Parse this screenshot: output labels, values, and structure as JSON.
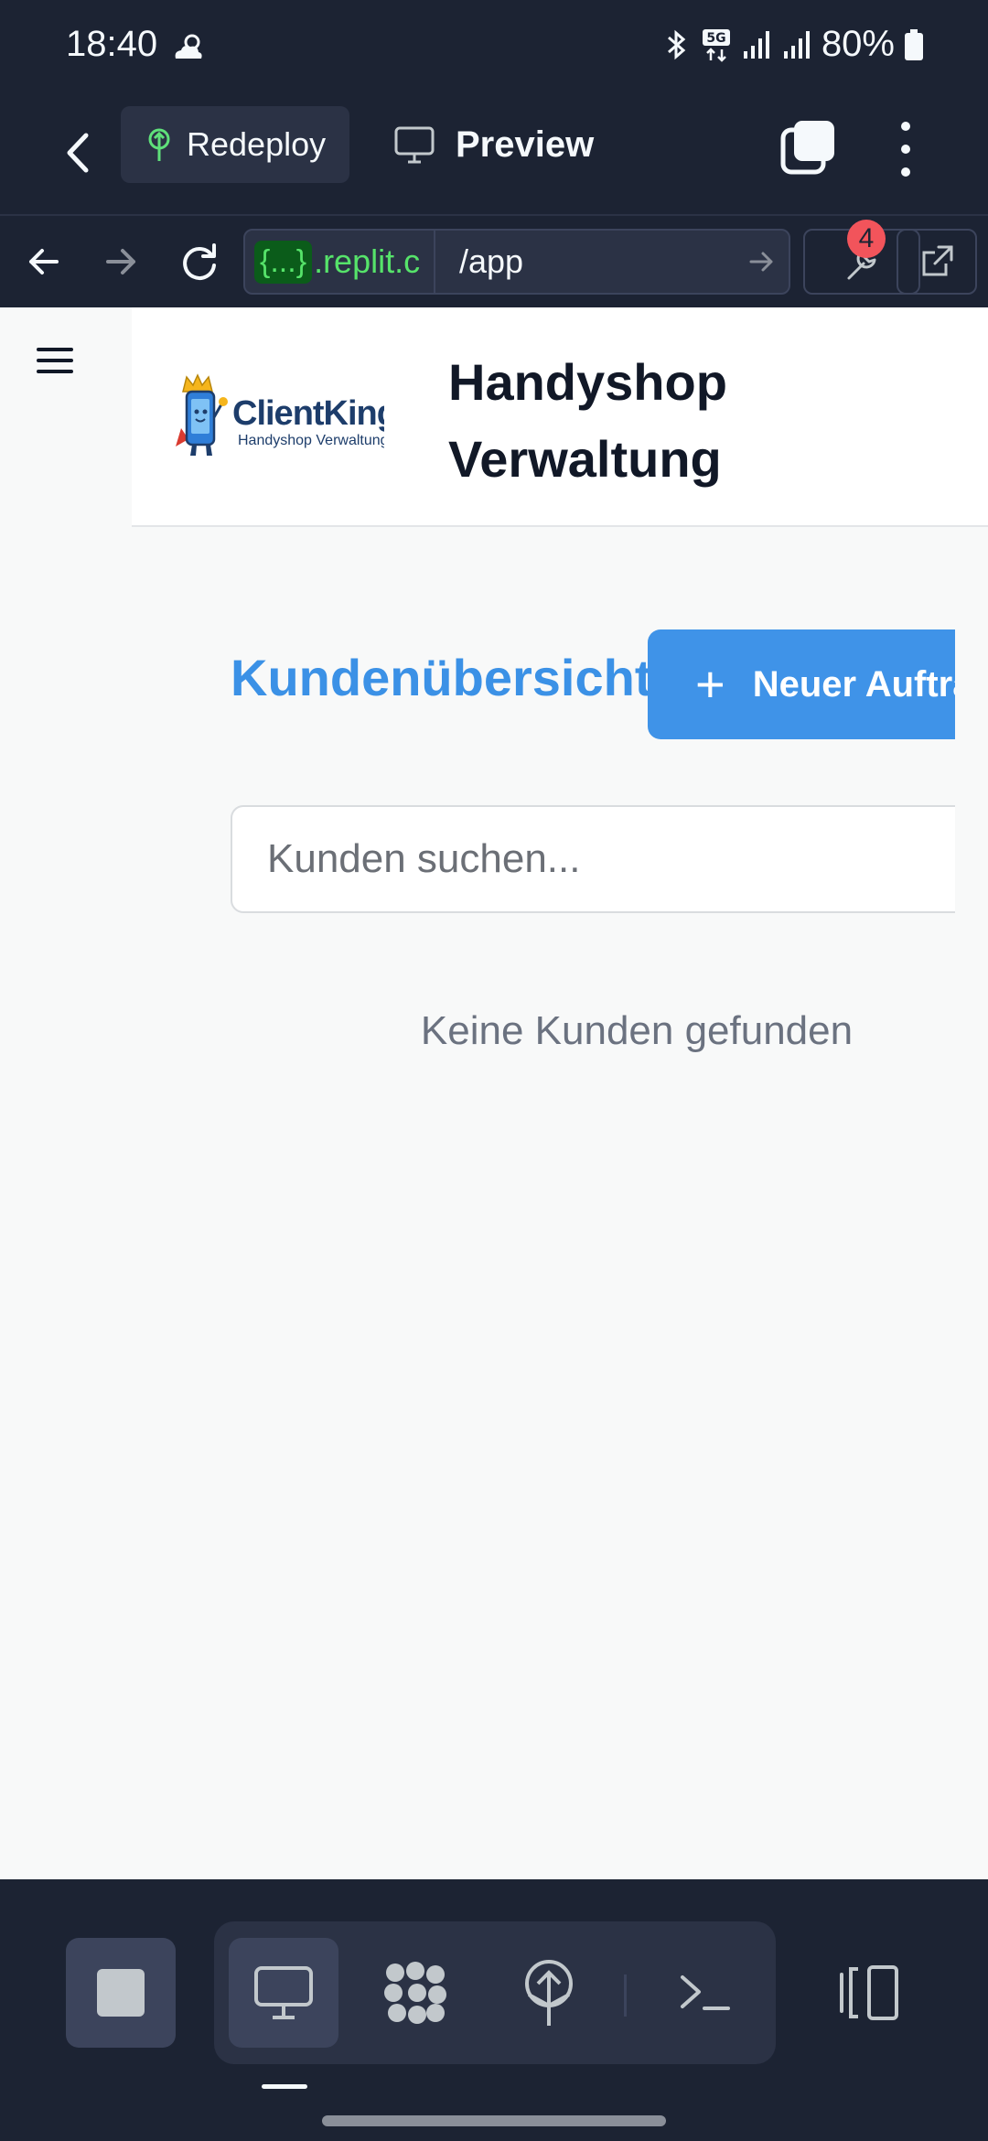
{
  "status_bar": {
    "time": "18:40",
    "battery": "80%",
    "icons": [
      "cloud-sun-icon",
      "bluetooth-icon",
      "5g-icon",
      "signal-icon",
      "signal-icon",
      "battery-icon"
    ]
  },
  "replit_header": {
    "redeploy_label": "Redeploy",
    "preview_label": "Preview"
  },
  "url_bar": {
    "host_badge": "{...}",
    "host_domain": ".replit.c",
    "path": "/app",
    "notification_count": "4"
  },
  "app": {
    "logo_text": "ClientKing",
    "logo_subtitle": "Handyshop Verwaltung",
    "title_line1": "Handyshop",
    "title_line2": "Verwaltung",
    "page_title": "Kundenübersicht",
    "new_order_button": "Neuer Auftrag",
    "search_placeholder": "Kunden suchen...",
    "empty_message": "Keine Kunden gefunden"
  },
  "colors": {
    "replit_bg": "#1c2333",
    "accent_blue": "#3f93e8",
    "page_title": "#3b91e6",
    "url_green": "#56e36a",
    "badge_red": "#f2545b"
  }
}
